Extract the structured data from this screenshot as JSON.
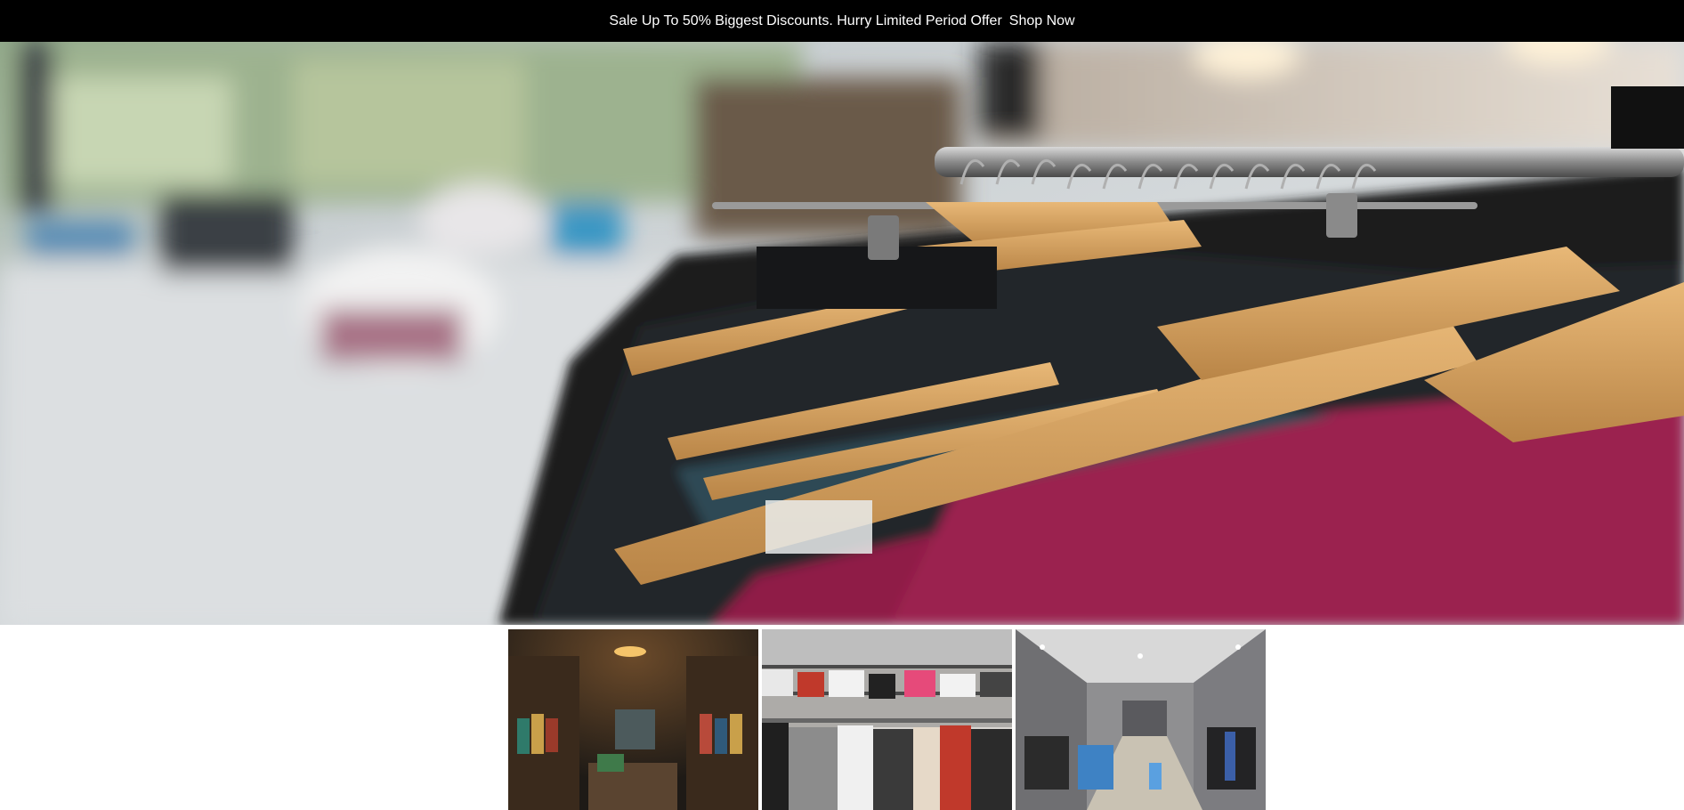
{
  "announcement": {
    "text": "Sale Up To 50% Biggest Discounts. Hurry Limited Period Offer",
    "link_label": "Shop Now"
  },
  "hero": {
    "image_description": "clothing-rack-with-wooden-hangers"
  },
  "gallery": [
    {
      "name": "boutique-interior"
    },
    {
      "name": "clothing-racks-store"
    },
    {
      "name": "modern-menswear-store"
    }
  ],
  "colors": {
    "announcement_bg": "#000000",
    "announcement_text": "#ffffff",
    "page_bg": "#ffffff"
  }
}
